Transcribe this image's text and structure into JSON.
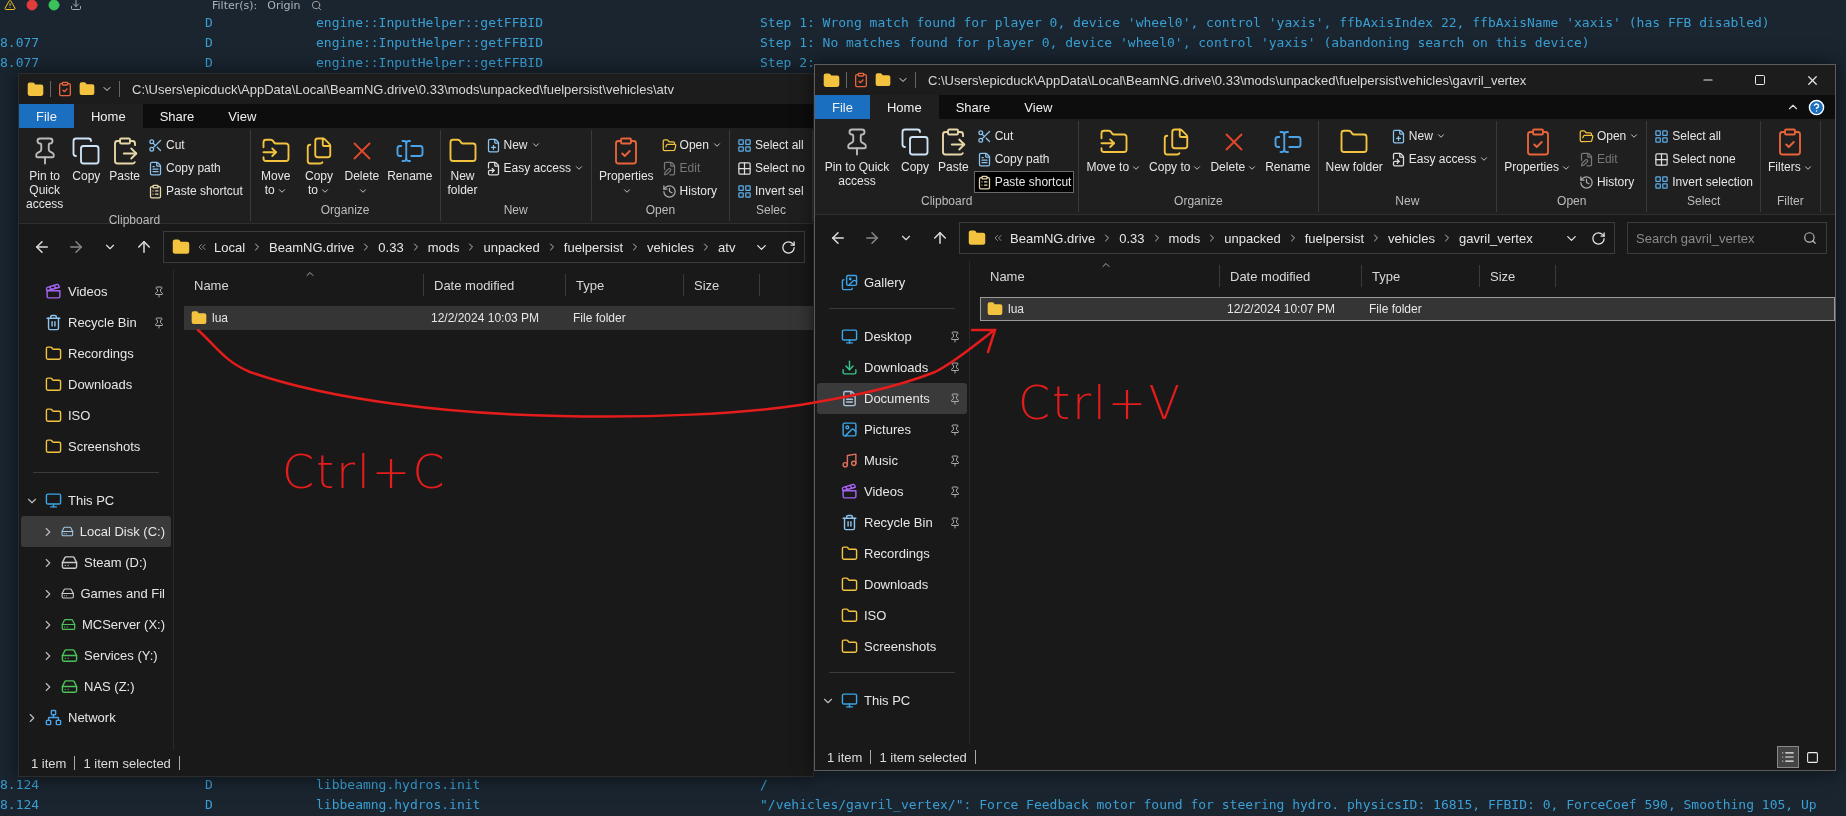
{
  "console": {
    "toolbar": {
      "filter_label": "Filter(s):",
      "origin_label": "Origin"
    },
    "top_rows": [
      {
        "level": "D",
        "source": "engine::InputHelper::getFFBID",
        "message": "Step 1: Wrong match found for player 0, device 'wheel0', control 'yaxis', ffbAxisIndex 22, ffbAxisName 'xaxis' (has FFB disabled)"
      },
      {
        "time": "8.077",
        "level": "D",
        "source": "engine::InputHelper::getFFBID",
        "message": "Step 1: No matches found for player 0, device 'wheel0', control 'yaxis' (abandoning search on this device)"
      },
      {
        "time": "8.077",
        "level": "D",
        "source": "engine::InputHelper::getFFBID",
        "message": "Step 2:"
      }
    ],
    "bottom_rows": [
      {
        "time": "8.124",
        "level": "D",
        "source": "libbeamng.hydros.init",
        "message": "/"
      },
      {
        "time": "8.124",
        "level": "D",
        "source": "libbeamng.hydros.init",
        "message": "\"/vehicles/gavril_vertex/\": Force Feedback motor found for steering hydro. physicsID: 16815, FFBID: 0, ForceCoef 590, Smoothing 105, Up"
      }
    ]
  },
  "windows": [
    {
      "title_path": "C:\\Users\\epicduck\\AppData\\Local\\BeamNG.drive\\0.33\\mods\\unpacked\\fuelpersist\\vehicles\\atv",
      "caption_buttons": false,
      "tabs": [
        {
          "label": "File",
          "kind": "file",
          "selected": false
        },
        {
          "label": "Home",
          "kind": "tab",
          "selected": true
        },
        {
          "label": "Share",
          "kind": "tab",
          "selected": false
        },
        {
          "label": "View",
          "kind": "tab",
          "selected": false
        }
      ],
      "ribbon": [
        {
          "label": "Clipboard",
          "items": [
            {
              "kind": "pin",
              "label": "Pin to Quick access"
            },
            {
              "kind": "copy",
              "label": "Copy"
            },
            {
              "kind": "paste",
              "label": "Paste"
            },
            {
              "kind": "cut",
              "label": "Cut"
            },
            {
              "kind": "copy_path",
              "label": "Copy path"
            },
            {
              "kind": "paste_shortcut",
              "label": "Paste shortcut",
              "highlighted": false
            }
          ]
        },
        {
          "label": "Organize",
          "items": [
            {
              "kind": "move_to",
              "label": "Move to",
              "dropdown": true
            },
            {
              "kind": "copy_to",
              "label": "Copy to",
              "dropdown": true
            },
            {
              "kind": "delete",
              "label": "Delete",
              "dropdown": true
            },
            {
              "kind": "rename",
              "label": "Rename"
            }
          ]
        },
        {
          "label": "New",
          "items": [
            {
              "kind": "new_folder",
              "label": "New folder"
            },
            {
              "kind": "new_item",
              "label": "New",
              "dropdown": true
            },
            {
              "kind": "easy_access",
              "label": "Easy access",
              "dropdown": true
            }
          ]
        },
        {
          "label": "Open",
          "items": [
            {
              "kind": "properties",
              "label": "Properties",
              "dropdown": true
            },
            {
              "kind": "open",
              "label": "Open",
              "dropdown": true
            },
            {
              "kind": "edit",
              "label": "Edit",
              "disabled": true
            },
            {
              "kind": "history",
              "label": "History"
            }
          ]
        },
        {
          "label": "Selec",
          "items": [
            {
              "kind": "select_all",
              "label": "Select all"
            },
            {
              "kind": "select_none",
              "label": "Select no"
            },
            {
              "kind": "invert_selection",
              "label": "Invert sel"
            }
          ]
        }
      ],
      "address": [
        "Local",
        "BeamNG.drive",
        "0.33",
        "mods",
        "unpacked",
        "fuelpersist",
        "vehicles",
        "atv"
      ],
      "columns": [
        "Name",
        "Date modified",
        "Type",
        "Size"
      ],
      "rows": [
        {
          "name": "lua",
          "date": "12/2/2024 10:03 PM",
          "type": "File folder",
          "selected": true,
          "focused": false
        }
      ],
      "nav": [
        {
          "kind": "videos",
          "label": "Videos",
          "pinned": true,
          "selected": false
        },
        {
          "kind": "recycle",
          "label": "Recycle Bin",
          "pinned": true,
          "selected": false
        },
        {
          "kind": "folder",
          "label": "Recordings",
          "pinned": false,
          "selected": false
        },
        {
          "kind": "folder",
          "label": "Downloads",
          "pinned": false,
          "selected": false
        },
        {
          "kind": "folder",
          "label": "ISO",
          "pinned": false,
          "selected": false
        },
        {
          "kind": "folder",
          "label": "Screenshots",
          "pinned": false,
          "selected": false
        },
        {
          "kind": "divider"
        },
        {
          "kind": "pc",
          "label": "This PC",
          "pinned": false,
          "selected": false,
          "expanded": true,
          "children": [
            {
              "kind": "system_drive",
              "label": "Local Disk (C:)",
              "pinned": false,
              "selected": true,
              "expanded": false
            },
            {
              "kind": "drive",
              "label": "Steam (D:)",
              "pinned": false,
              "selected": false,
              "expanded": false
            },
            {
              "kind": "drive",
              "label": "Games and Fil",
              "pinned": false,
              "selected": false,
              "expanded": false
            },
            {
              "kind": "net_drive",
              "label": "MCServer (X:)",
              "pinned": false,
              "selected": false,
              "expanded": false
            },
            {
              "kind": "net_drive",
              "label": "Services (Y:)",
              "pinned": false,
              "selected": false,
              "expanded": false
            },
            {
              "kind": "net_drive",
              "label": "NAS (Z:)",
              "pinned": false,
              "selected": false,
              "expanded": false
            }
          ]
        },
        {
          "kind": "network",
          "label": "Network",
          "pinned": false,
          "selected": false,
          "expanded": false
        }
      ],
      "status": [
        "1 item",
        "1 item selected"
      ]
    },
    {
      "title_path": "C:\\Users\\epicduck\\AppData\\Local\\BeamNG.drive\\0.33\\mods\\unpacked\\fuelpersist\\vehicles\\gavril_vertex",
      "caption_buttons": true,
      "tabs": [
        {
          "label": "File",
          "kind": "file",
          "selected": false
        },
        {
          "label": "Home",
          "kind": "tab",
          "selected": true
        },
        {
          "label": "Share",
          "kind": "tab",
          "selected": false
        },
        {
          "label": "View",
          "kind": "tab",
          "selected": false
        }
      ],
      "ribbon": [
        {
          "label": "Clipboard",
          "items": [
            {
              "kind": "pin",
              "label": "Pin to Quick access"
            },
            {
              "kind": "copy",
              "label": "Copy"
            },
            {
              "kind": "paste",
              "label": "Paste"
            },
            {
              "kind": "cut",
              "label": "Cut"
            },
            {
              "kind": "copy_path",
              "label": "Copy path"
            },
            {
              "kind": "paste_shortcut",
              "label": "Paste shortcut",
              "highlighted": true
            }
          ]
        },
        {
          "label": "Organize",
          "items": [
            {
              "kind": "move_to",
              "label": "Move to",
              "dropdown": true
            },
            {
              "kind": "copy_to",
              "label": "Copy to",
              "dropdown": true
            },
            {
              "kind": "delete",
              "label": "Delete",
              "dropdown": true
            },
            {
              "kind": "rename",
              "label": "Rename"
            }
          ]
        },
        {
          "label": "New",
          "items": [
            {
              "kind": "new_folder",
              "label": "New folder"
            },
            {
              "kind": "new_item",
              "label": "New",
              "dropdown": true
            },
            {
              "kind": "easy_access",
              "label": "Easy access",
              "dropdown": true
            }
          ]
        },
        {
          "label": "Open",
          "items": [
            {
              "kind": "properties",
              "label": "Properties",
              "dropdown": true
            },
            {
              "kind": "open",
              "label": "Open",
              "dropdown": true
            },
            {
              "kind": "edit",
              "label": "Edit",
              "disabled": true
            },
            {
              "kind": "history",
              "label": "History"
            }
          ]
        },
        {
          "label": "Select",
          "items": [
            {
              "kind": "select_all",
              "label": "Select all"
            },
            {
              "kind": "select_none",
              "label": "Select none"
            },
            {
              "kind": "invert_selection",
              "label": "Invert selection"
            }
          ]
        },
        {
          "label": "Filter",
          "items": [
            {
              "kind": "filters",
              "label": "Filters",
              "dropdown": true
            }
          ]
        }
      ],
      "address": [
        "BeamNG.drive",
        "0.33",
        "mods",
        "unpacked",
        "fuelpersist",
        "vehicles",
        "gavril_vertex"
      ],
      "search": {
        "placeholder": "Search gavril_vertex"
      },
      "columns": [
        "Name",
        "Date modified",
        "Type",
        "Size"
      ],
      "rows": [
        {
          "name": "lua",
          "date": "12/2/2024 10:07 PM",
          "type": "File folder",
          "selected": true,
          "focused": true
        }
      ],
      "nav": [
        {
          "kind": "gallery",
          "label": "Gallery",
          "pinned": false,
          "selected": false
        },
        {
          "kind": "divider"
        },
        {
          "kind": "desktop",
          "label": "Desktop",
          "pinned": true,
          "selected": false
        },
        {
          "kind": "downloads",
          "label": "Downloads",
          "pinned": true,
          "selected": false
        },
        {
          "kind": "documents",
          "label": "Documents",
          "pinned": true,
          "selected": true
        },
        {
          "kind": "pictures",
          "label": "Pictures",
          "pinned": true,
          "selected": false
        },
        {
          "kind": "music",
          "label": "Music",
          "pinned": true,
          "selected": false
        },
        {
          "kind": "videos",
          "label": "Videos",
          "pinned": true,
          "selected": false
        },
        {
          "kind": "recycle",
          "label": "Recycle Bin",
          "pinned": true,
          "selected": false
        },
        {
          "kind": "folder",
          "label": "Recordings",
          "pinned": false,
          "selected": false
        },
        {
          "kind": "folder",
          "label": "Downloads",
          "pinned": false,
          "selected": false
        },
        {
          "kind": "folder",
          "label": "ISO",
          "pinned": false,
          "selected": false
        },
        {
          "kind": "folder",
          "label": "Screenshots",
          "pinned": false,
          "selected": false
        },
        {
          "kind": "divider"
        },
        {
          "kind": "pc",
          "label": "This PC",
          "pinned": false,
          "selected": false,
          "expanded": true
        }
      ],
      "status": [
        "1 item",
        "1 item selected"
      ],
      "views": [
        {
          "kind": "details",
          "selected": true
        },
        {
          "kind": "large_icons",
          "selected": false
        }
      ]
    }
  ],
  "annotations": [
    {
      "kind": "copy_note",
      "text": "Ctrl+C"
    },
    {
      "kind": "paste_note",
      "text": "Ctrl+V"
    }
  ]
}
